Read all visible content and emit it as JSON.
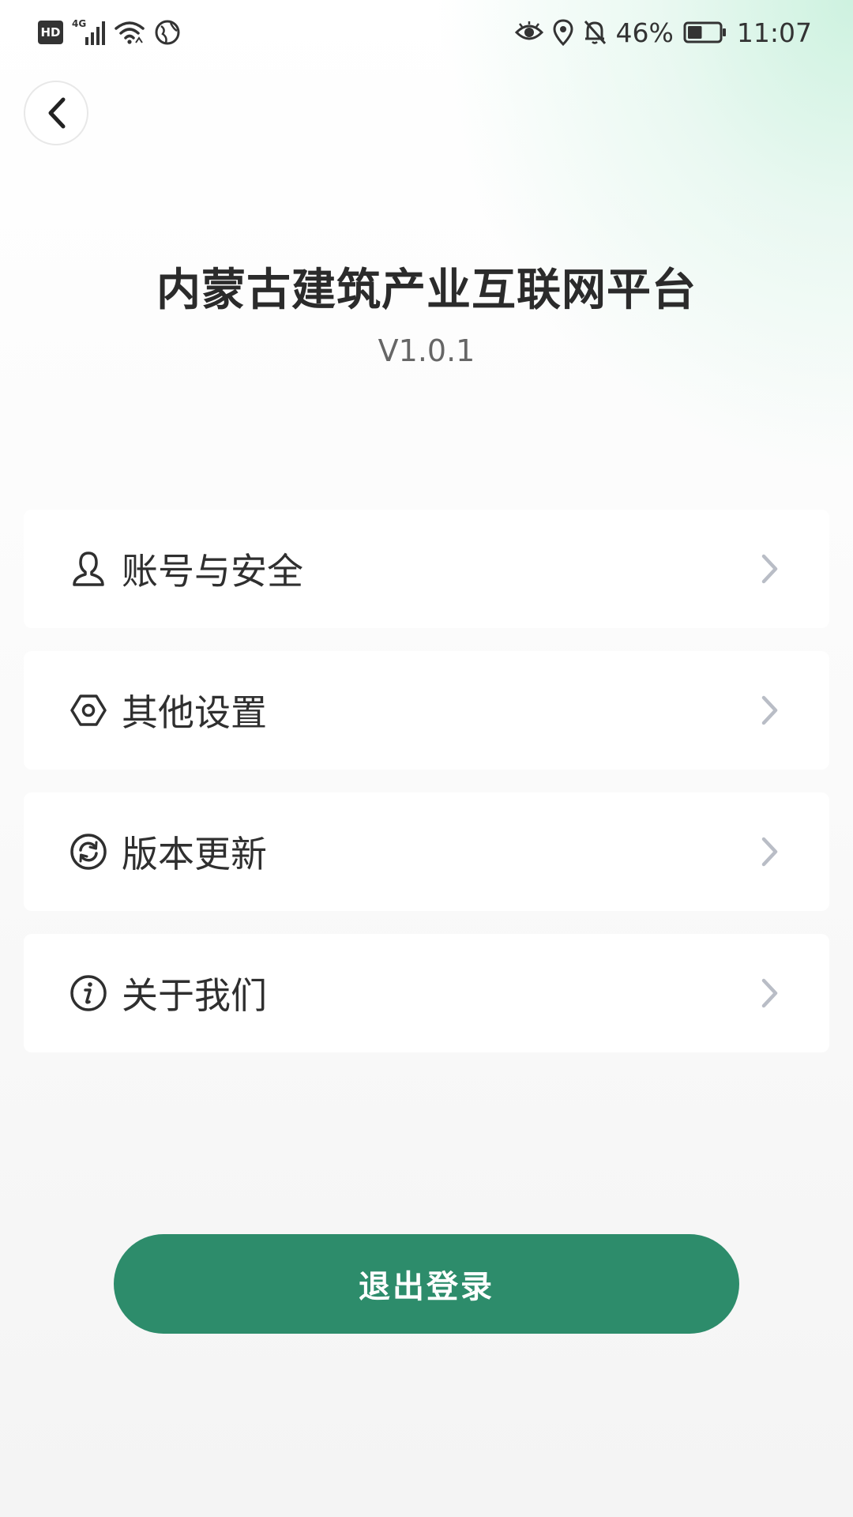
{
  "status_bar": {
    "network_badge": "HD",
    "network_type": "4G",
    "battery_percent": "46%",
    "time": "11:07",
    "battery_level": 0.46
  },
  "header": {
    "title": "内蒙古建筑产业互联网平台",
    "version": "V1.0.1"
  },
  "menu": {
    "items": [
      {
        "label": "账号与安全",
        "icon": "user-icon"
      },
      {
        "label": "其他设置",
        "icon": "hexagon-settings-icon"
      },
      {
        "label": "版本更新",
        "icon": "refresh-icon"
      },
      {
        "label": "关于我们",
        "icon": "info-icon"
      }
    ]
  },
  "actions": {
    "logout_label": "退出登录"
  },
  "colors": {
    "accent": "#2d8c6b",
    "chevron": "#b9bdc6",
    "text": "#2f2f2f"
  }
}
